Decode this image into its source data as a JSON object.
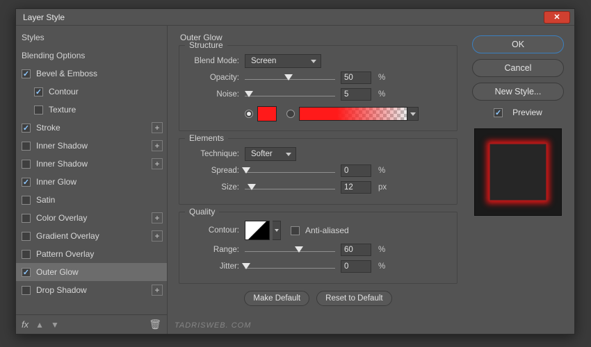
{
  "window": {
    "title": "Layer Style"
  },
  "styles": {
    "header": "Styles",
    "blending": "Blending Options",
    "items": [
      {
        "label": "Bevel & Emboss",
        "checked": true,
        "plus": false,
        "indent": false
      },
      {
        "label": "Contour",
        "checked": true,
        "plus": false,
        "indent": true
      },
      {
        "label": "Texture",
        "checked": false,
        "plus": false,
        "indent": true
      },
      {
        "label": "Stroke",
        "checked": true,
        "plus": true,
        "indent": false
      },
      {
        "label": "Inner Shadow",
        "checked": false,
        "plus": true,
        "indent": false
      },
      {
        "label": "Inner Shadow",
        "checked": false,
        "plus": true,
        "indent": false
      },
      {
        "label": "Inner Glow",
        "checked": true,
        "plus": false,
        "indent": false
      },
      {
        "label": "Satin",
        "checked": false,
        "plus": false,
        "indent": false
      },
      {
        "label": "Color Overlay",
        "checked": false,
        "plus": true,
        "indent": false
      },
      {
        "label": "Gradient Overlay",
        "checked": false,
        "plus": true,
        "indent": false
      },
      {
        "label": "Pattern Overlay",
        "checked": false,
        "plus": false,
        "indent": false
      },
      {
        "label": "Outer Glow",
        "checked": true,
        "plus": false,
        "indent": false,
        "selected": true
      },
      {
        "label": "Drop Shadow",
        "checked": false,
        "plus": true,
        "indent": false
      }
    ],
    "fx_label": "fx"
  },
  "panel": {
    "title": "Outer Glow",
    "structure": {
      "group": "Structure",
      "blend_mode_label": "Blend Mode:",
      "blend_mode_value": "Screen",
      "opacity_label": "Opacity:",
      "opacity_value": "50",
      "opacity_unit": "%",
      "noise_label": "Noise:",
      "noise_value": "5",
      "noise_unit": "%",
      "color_hex": "#ff1a1a"
    },
    "elements": {
      "group": "Elements",
      "technique_label": "Technique:",
      "technique_value": "Softer",
      "spread_label": "Spread:",
      "spread_value": "0",
      "spread_unit": "%",
      "size_label": "Size:",
      "size_value": "12",
      "size_unit": "px"
    },
    "quality": {
      "group": "Quality",
      "contour_label": "Contour:",
      "antialiased_label": "Anti-aliased",
      "range_label": "Range:",
      "range_value": "60",
      "range_unit": "%",
      "jitter_label": "Jitter:",
      "jitter_value": "0",
      "jitter_unit": "%"
    },
    "buttons": {
      "make_default": "Make Default",
      "reset_default": "Reset to Default"
    }
  },
  "right": {
    "ok": "OK",
    "cancel": "Cancel",
    "new_style": "New Style...",
    "preview": "Preview"
  },
  "watermark": "TADRISWEB. COM"
}
